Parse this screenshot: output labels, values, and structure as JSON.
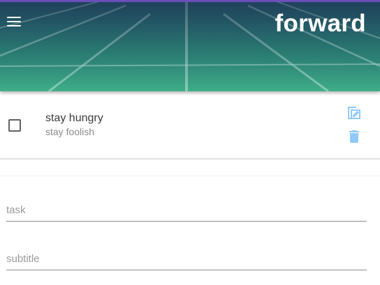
{
  "header": {
    "title": "forward",
    "menu_icon": "hamburger-menu-icon"
  },
  "task": {
    "title": "stay hungry",
    "subtitle": "stay foolish",
    "checked": false,
    "edit_icon": "edit-icon",
    "delete_icon": "trash-icon"
  },
  "form": {
    "task_placeholder": "task",
    "task_value": "",
    "subtitle_placeholder": "subtitle",
    "subtitle_value": ""
  },
  "colors": {
    "header_gradient_start": "#1f6e6e",
    "header_gradient_end": "#48b891",
    "top_strip": "#6b4fb8",
    "action_icon": "#90caf9"
  }
}
